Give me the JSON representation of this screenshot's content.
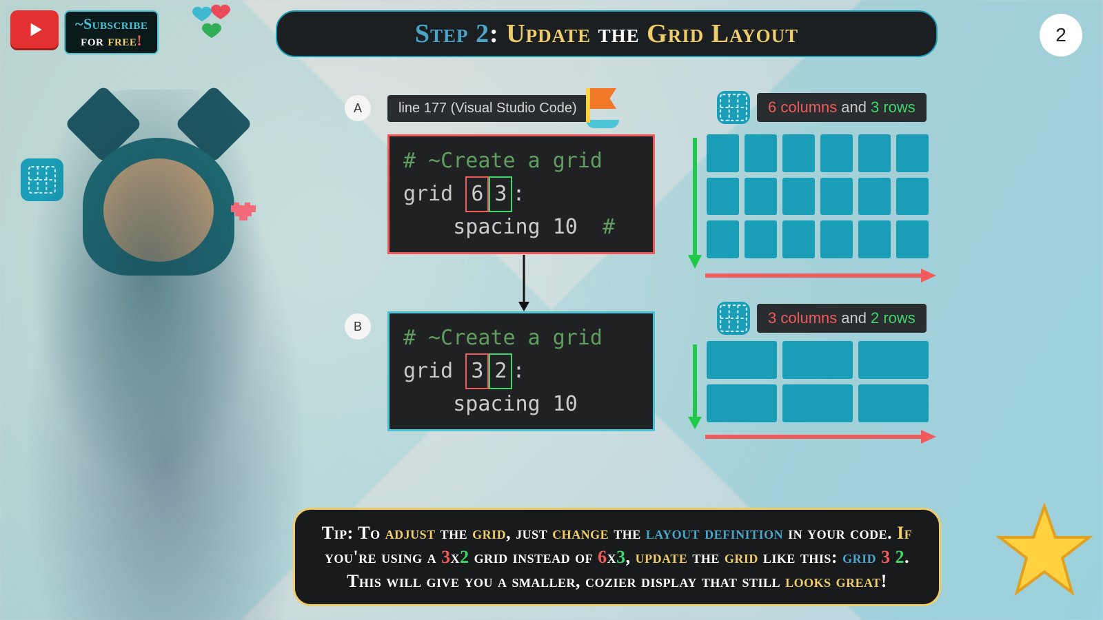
{
  "subscribe": {
    "line1": "~Subscribe",
    "for": "for",
    "free": "free",
    "exc": "!"
  },
  "title": {
    "step": "Step 2",
    "rest_a": "Update",
    "rest_b": "the",
    "rest_c": "Grid Layout"
  },
  "page_number": "2",
  "lineinfo": "line 177 (Visual Studio Code)",
  "labels": {
    "a": "A",
    "b": "B"
  },
  "code_a": {
    "comment": "# ~Create a grid",
    "kw": "grid",
    "n1": "6",
    "n2": "3",
    "colon": ":",
    "spacing": "spacing 10",
    "tailhash": "#"
  },
  "code_b": {
    "comment": "# ~Create a grid",
    "kw": "grid",
    "n1": "3",
    "n2": "2",
    "colon": ":",
    "spacing": "spacing 10"
  },
  "legend_a": {
    "cols": "6 columns",
    "and": "and",
    "rows": "3 rows"
  },
  "legend_b": {
    "cols": "3 columns",
    "and": "and",
    "rows": "2 rows"
  },
  "grids": {
    "a": {
      "cols": 6,
      "rows": 3
    },
    "b": {
      "cols": 3,
      "rows": 2
    }
  },
  "tip": {
    "t1": "Tip: To ",
    "adjust": "adjust",
    " t2": " the ",
    "grid": "grid",
    " t3": ", just ",
    "change": "change",
    " t4": " the ",
    "layout": "layout definition",
    "t5": " in your code. ",
    "if": "If",
    " t6": " you're using a ",
    "d3": "3",
    "x": "x",
    "d2": "2",
    " t7": " grid instead of ",
    "d6": "6",
    "x2": "x",
    "d3b": "3",
    "t8": ", ",
    "update": "update",
    " t9": " the ",
    "grid2": "grid",
    " t10": " like this: ",
    "kw": "grid ",
    "n3": "3 ",
    "n2b": "2",
    "t11": ". This will give you a smaller, cozier display that still ",
    "looks": "looks great",
    "exc": "!"
  }
}
